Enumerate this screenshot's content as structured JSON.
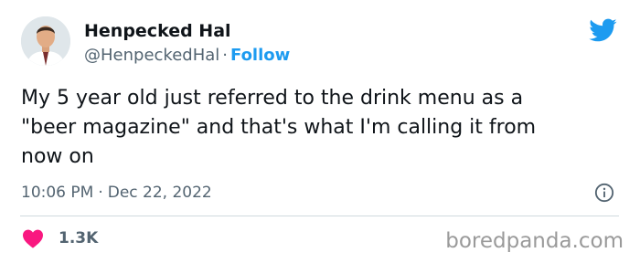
{
  "author": {
    "display_name": "Henpecked Hal",
    "handle": "@HenpeckedHal",
    "separator": "·",
    "follow_label": "Follow"
  },
  "tweet": {
    "text": "My 5 year old just referred to the drink menu as a\n\"beer magazine\" and that's what I'm calling it from\nnow on",
    "time": "10:06 PM",
    "separator": "·",
    "date": "Dec 22, 2022"
  },
  "engagement": {
    "likes": "1.3K"
  },
  "watermark": "boredpanda.com",
  "icons": {
    "brand": "twitter-bird-icon",
    "info": "info-icon",
    "like": "heart-icon"
  },
  "colors": {
    "brand_blue": "#1d9bf0",
    "like_pink": "#f91880",
    "secondary_text": "#536471",
    "primary_text": "#0f1419"
  }
}
